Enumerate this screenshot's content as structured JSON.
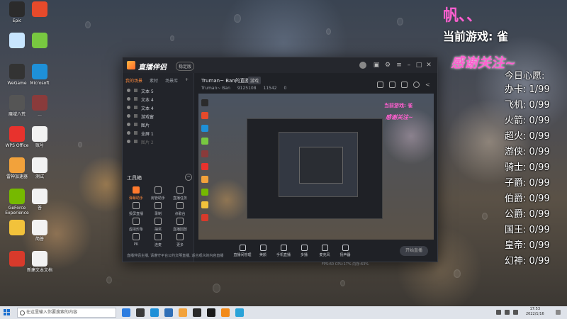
{
  "desktop_icons": [
    {
      "label": "Epic",
      "name": "epic-launcher-icon",
      "color": "#2b2b2b"
    },
    {
      "label": "",
      "name": "app-icon-2",
      "color": "#e64a2b"
    },
    {
      "label": "",
      "name": "app-icon-3",
      "color": "#c8e6ff"
    },
    {
      "label": "",
      "name": "app-icon-4",
      "color": "#78c840"
    },
    {
      "label": "WeGame",
      "name": "wegame-icon",
      "color": "#333"
    },
    {
      "label": "Microsoft",
      "name": "edge-icon",
      "color": "#1e90d8"
    },
    {
      "label": "魔域八荒",
      "name": "game-icon-1",
      "color": "#555"
    },
    {
      "label": "...",
      "name": "game-icon-2",
      "color": "#8a3b3b"
    },
    {
      "label": "WPS Office",
      "name": "wps-icon",
      "color": "#e8322d"
    },
    {
      "label": "账号",
      "name": "file-icon-1",
      "color": "#f2f2f2"
    },
    {
      "label": "雷神加速器",
      "name": "accelerator-icon",
      "color": "#f2a23b"
    },
    {
      "label": "测试",
      "name": "file-icon-2",
      "color": "#f2f2f2"
    },
    {
      "label": "GeForce Experience",
      "name": "geforce-icon",
      "color": "#76b900"
    },
    {
      "label": "答",
      "name": "file-icon-3",
      "color": "#f2f2f2"
    },
    {
      "label": "",
      "name": "owl-app-icon",
      "color": "#f2c23b"
    },
    {
      "label": "简答",
      "name": "file-icon-4",
      "color": "#f2f2f2"
    },
    {
      "label": "",
      "name": "app-icon-red",
      "color": "#d83a2b"
    },
    {
      "label": "新建文本文档",
      "name": "file-icon-5",
      "color": "#f2f2f2"
    }
  ],
  "overlay": {
    "title": "帆、、",
    "game_line": "当前游戏: 雀",
    "thanks": "感谢关注~",
    "wishes_title": "今日心愿:",
    "wishes": [
      {
        "name": "办卡",
        "value": "1/99"
      },
      {
        "name": "飞机",
        "value": "0/99"
      },
      {
        "name": "火箭",
        "value": "0/99"
      },
      {
        "name": "超火",
        "value": "0/99"
      },
      {
        "name": "游侠",
        "value": "0/99"
      },
      {
        "name": "骑士",
        "value": "0/99"
      },
      {
        "name": "子爵",
        "value": "0/99"
      },
      {
        "name": "伯爵",
        "value": "0/99"
      },
      {
        "name": "公爵",
        "value": "0/99"
      },
      {
        "name": "国王",
        "value": "0/99"
      },
      {
        "name": "皇帝",
        "value": "0/99"
      },
      {
        "name": "幻神",
        "value": "0/99"
      }
    ]
  },
  "app": {
    "name": "直播伴侣",
    "version": "稳定版",
    "side_tabs": [
      "我的场景",
      "素材",
      "场景库"
    ],
    "scenes": [
      {
        "label": "文本 5",
        "dim": false
      },
      {
        "label": "文本 4",
        "dim": false
      },
      {
        "label": "文本 4",
        "dim": false
      },
      {
        "label": "游戏窗",
        "dim": false
      },
      {
        "label": "图片",
        "dim": false
      },
      {
        "label": "全屏 1",
        "dim": false
      },
      {
        "label": "图片 2",
        "dim": true
      }
    ],
    "toolbox_title": "工具箱",
    "tools": [
      {
        "label": "弹幕助手",
        "icon": "danmaku-icon",
        "orange": true
      },
      {
        "label": "房管助手",
        "icon": "manager-icon",
        "orange": false
      },
      {
        "label": "直播任务",
        "icon": "task-icon",
        "orange": false
      },
      {
        "label": "投屏直播",
        "icon": "cast-icon",
        "orange": false
      },
      {
        "label": "录制",
        "icon": "record-icon",
        "orange": false
      },
      {
        "label": "点歌台",
        "icon": "song-icon",
        "orange": false
      },
      {
        "label": "虚拟形象",
        "icon": "avatar-icon",
        "orange": false
      },
      {
        "label": "抽奖",
        "icon": "lottery-icon",
        "orange": false
      },
      {
        "label": "直播回放",
        "icon": "replay-icon",
        "orange": false
      },
      {
        "label": "PK",
        "icon": "pk-icon",
        "orange": false
      },
      {
        "label": "连麦",
        "icon": "mic-link-icon",
        "orange": false
      },
      {
        "label": "更多",
        "icon": "more-icon",
        "orange": false
      }
    ],
    "notice": "直播伴侣主播, 请遵守平台公约文明直播, 适合观众的内容直播",
    "room_title": "Truman~ Ban的直播间",
    "room_tag": "游戏",
    "room_info": [
      "Truman~ Ban",
      "9125108",
      "11542",
      "0"
    ],
    "pink_preview_game": "当前游戏: 雀",
    "pink_preview_thanks": "感谢关注~",
    "controls": [
      "直播间管理",
      "美颜",
      "手机直播",
      "多播",
      "麦克风",
      "扬声器"
    ],
    "start_label": "开始直播",
    "status": "FPS:60  CPU:17%  内存:63%"
  },
  "taskbar": {
    "search_placeholder": "在这里输入你要搜索的内容",
    "time": "17:53",
    "date": "2022/1/16",
    "colors": [
      "#2d7de0",
      "#3a3a3a",
      "#1e90d8",
      "#2f6fb7",
      "#f2a23b",
      "#2a2a2a",
      "#1a1a1a",
      "#f28a1a",
      "#2aa3d8"
    ]
  }
}
